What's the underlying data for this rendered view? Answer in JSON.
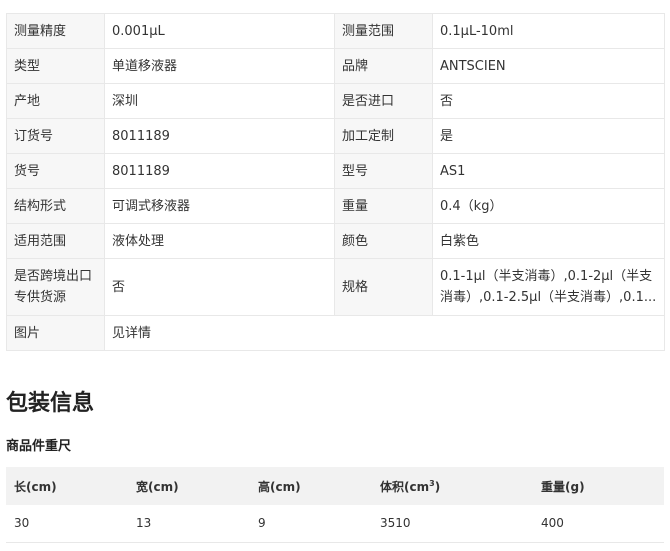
{
  "spec": {
    "rows": [
      [
        {
          "k": "测量精度",
          "v": "0.001μL"
        },
        {
          "k": "测量范围",
          "v": "0.1μL-10ml"
        }
      ],
      [
        {
          "k": "类型",
          "v": "单道移液器"
        },
        {
          "k": "品牌",
          "v": "ANTSCIEN"
        }
      ],
      [
        {
          "k": "产地",
          "v": "深圳"
        },
        {
          "k": "是否进口",
          "v": "否"
        }
      ],
      [
        {
          "k": "订货号",
          "v": "8011189"
        },
        {
          "k": "加工定制",
          "v": "是"
        }
      ],
      [
        {
          "k": "货号",
          "v": "8011189"
        },
        {
          "k": "型号",
          "v": "AS1"
        }
      ],
      [
        {
          "k": "结构形式",
          "v": "可调式移液器"
        },
        {
          "k": "重量",
          "v": "0.4（kg）"
        }
      ],
      [
        {
          "k": "适用范围",
          "v": "液体处理"
        },
        {
          "k": "颜色",
          "v": "白紫色"
        }
      ],
      [
        {
          "k": "是否跨境出口专供货源",
          "v": "否"
        },
        {
          "k": "规格",
          "v": "0.1-1μl（半支消毒）,0.1-2μl（半支消毒）,0.1-2.5μl（半支消毒）,0.1..."
        }
      ]
    ],
    "image_row": {
      "k": "图片",
      "v": "见详情"
    }
  },
  "packaging": {
    "title": "包装信息",
    "subtitle": "商品件重尺",
    "headers": {
      "length": "长(cm)",
      "width": "宽(cm)",
      "height": "高(cm)",
      "volume": "体积(cm",
      "volume_sup": "3",
      "volume_end": ")",
      "weight": "重量(g)"
    },
    "row": {
      "length": "30",
      "width": "13",
      "height": "9",
      "volume": "3510",
      "weight": "400"
    }
  }
}
